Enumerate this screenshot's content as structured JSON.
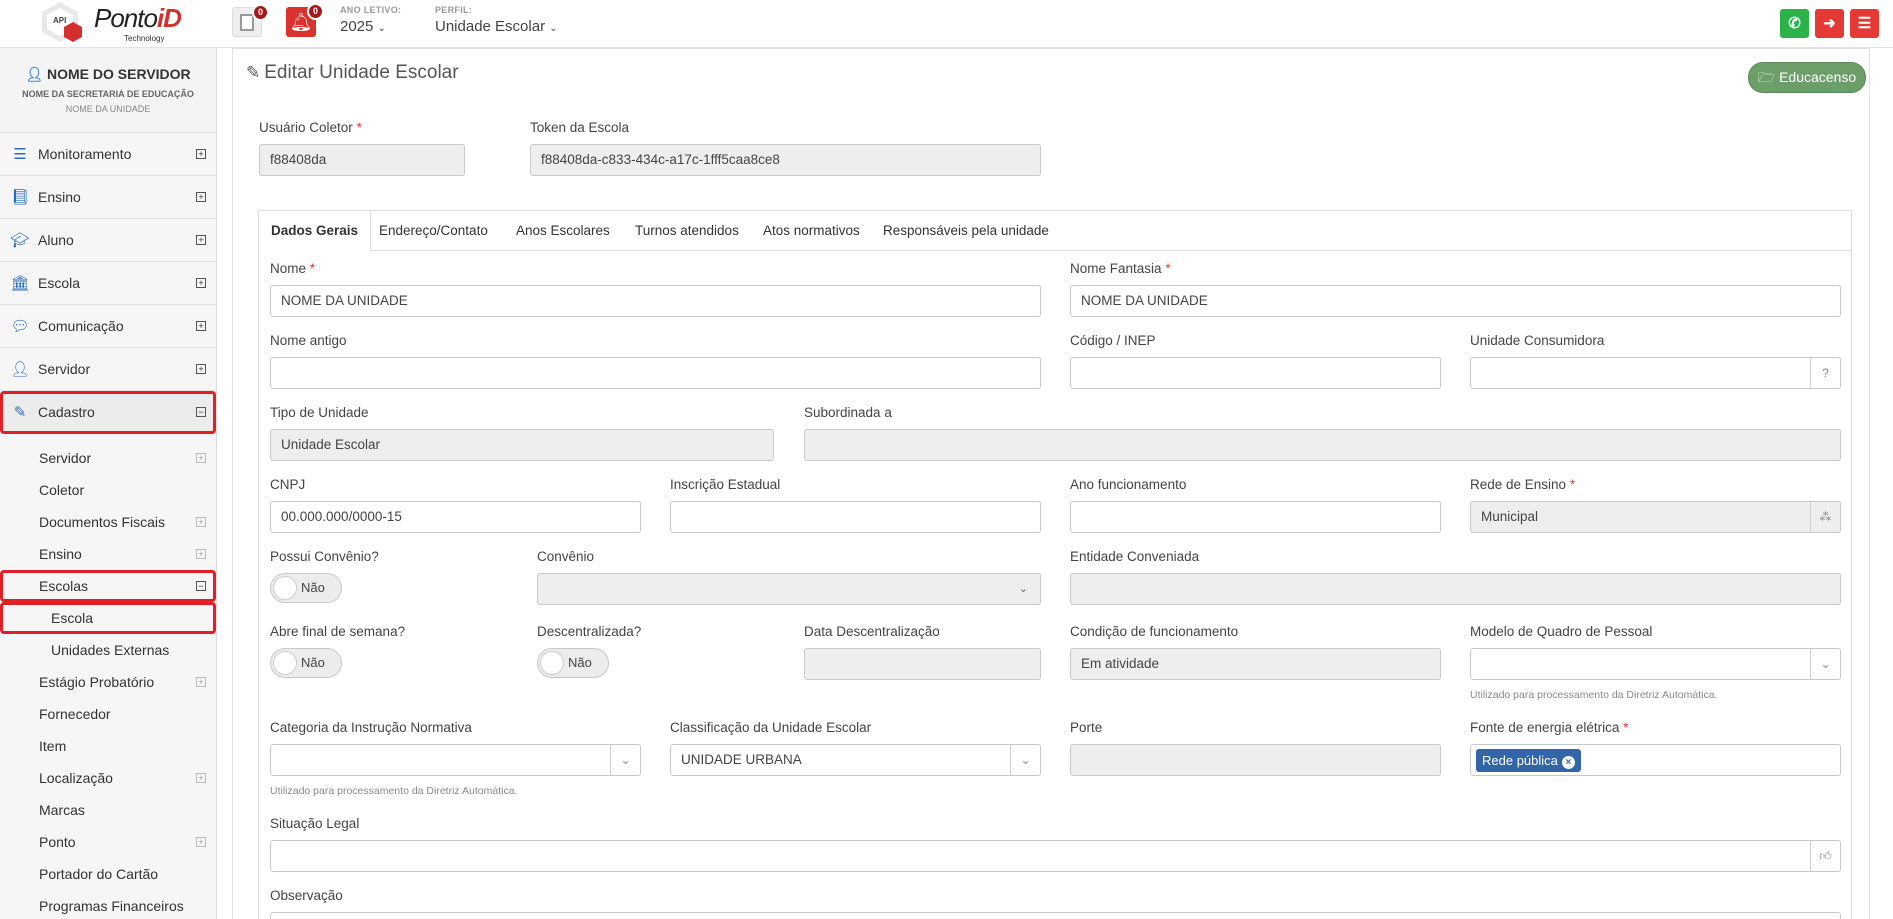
{
  "brand": {
    "api_mark": "API",
    "name_part1": "Ponto",
    "name_part2": "iD",
    "tagline": "Technology"
  },
  "topbar": {
    "docs_badge": "0",
    "alerts_badge": "0",
    "ano_letivo_label": "ANO LETIVO:",
    "ano_letivo_value": "2025",
    "perfil_label": "PERFIL:",
    "perfil_value": "Unidade Escolar",
    "icons": [
      "document-icon",
      "bell-icon",
      "whatsapp-icon",
      "sign-out-icon",
      "menu-icon"
    ],
    "colors": {
      "whatsapp": "#2bb34a",
      "danger": "#e53935"
    }
  },
  "user": {
    "name": "NOME DO SERVIDOR",
    "secretaria": "NOME DA SECRETARIA DE EDUCAÇÃO",
    "unidade": "NOME DA UNIDADE"
  },
  "sidebar": {
    "items": [
      {
        "label": "Monitoramento",
        "icon": "sliders-icon"
      },
      {
        "label": "Ensino",
        "icon": "book-icon"
      },
      {
        "label": "Aluno",
        "icon": "graduation-cap-icon"
      },
      {
        "label": "Escola",
        "icon": "institution-icon"
      },
      {
        "label": "Comunicação",
        "icon": "comment-icon"
      },
      {
        "label": "Servidor",
        "icon": "user-icon"
      },
      {
        "label": "Cadastro",
        "icon": "edit-icon"
      }
    ],
    "cadastro_sub": [
      "Servidor",
      "Coletor",
      "Documentos Fiscais",
      "Ensino",
      "Escolas",
      "Escola",
      "Unidades Externas",
      "Estágio Probatório",
      "Fornecedor",
      "Item",
      "Localização",
      "Marcas",
      "Ponto",
      "Portador do Cartão",
      "Programas Financeiros"
    ]
  },
  "page": {
    "title": "Editar Unidade Escolar",
    "educacenso_button": "Educacenso",
    "usuario_coletor": {
      "label": "Usuário Coletor",
      "value": "f88408da"
    },
    "token_escola": {
      "label": "Token da Escola",
      "value": "f88408da-c833-434c-a17c-1fff5caa8ce8"
    }
  },
  "tabs": [
    "Dados Gerais",
    "Endereço/Contato",
    "Anos Escolares",
    "Turnos atendidos",
    "Atos normativos",
    "Responsáveis pela unidade"
  ],
  "form": {
    "nome": {
      "label": "Nome",
      "value": "NOME DA UNIDADE"
    },
    "nome_fantasia": {
      "label": "Nome Fantasia",
      "value": "NOME DA UNIDADE"
    },
    "nome_antigo": {
      "label": "Nome antigo",
      "value": ""
    },
    "codigo_inep": {
      "label": "Código / INEP",
      "value": ""
    },
    "unidade_consumidora": {
      "label": "Unidade Consumidora",
      "value": "",
      "addon": "?"
    },
    "tipo_unidade": {
      "label": "Tipo de Unidade",
      "value": "Unidade Escolar"
    },
    "subordinada": {
      "label": "Subordinada a",
      "value": ""
    },
    "cnpj": {
      "label": "CNPJ",
      "value": "00.000.000/0000-15"
    },
    "inscricao_estadual": {
      "label": "Inscrição Estadual",
      "value": ""
    },
    "ano_funcionamento": {
      "label": "Ano funcionamento",
      "value": ""
    },
    "rede_ensino": {
      "label": "Rede de Ensino",
      "value": "Municipal"
    },
    "possui_convenio": {
      "label": "Possui Convênio?",
      "value": "Não"
    },
    "convenio": {
      "label": "Convênio",
      "value": ""
    },
    "entidade_conveniada": {
      "label": "Entidade Conveniada",
      "value": ""
    },
    "abre_fim_semana": {
      "label": "Abre final de semana?",
      "value": "Não"
    },
    "descentralizada": {
      "label": "Descentralizada?",
      "value": "Não"
    },
    "data_descentralizacao": {
      "label": "Data Descentralização",
      "value": ""
    },
    "condicao_funcionamento": {
      "label": "Condição de funcionamento",
      "value": "Em atividade"
    },
    "modelo_quadro": {
      "label": "Modelo de Quadro de Pessoal",
      "value": "",
      "hint": "Utilizado para processamento da Diretriz Automática."
    },
    "categoria_instrucao": {
      "label": "Categoria da Instrução Normativa",
      "value": "",
      "hint": "Utilizado para processamento da Diretriz Automática."
    },
    "classificacao": {
      "label": "Classificação da Unidade Escolar",
      "value": "UNIDADE URBANA"
    },
    "porte": {
      "label": "Porte",
      "value": ""
    },
    "fonte_energia": {
      "label": "Fonte de energia elétrica",
      "chip": "Rede pública"
    },
    "situacao_legal": {
      "label": "Situação Legal",
      "value": ""
    },
    "observacao": {
      "label": "Observação",
      "value": ""
    }
  }
}
